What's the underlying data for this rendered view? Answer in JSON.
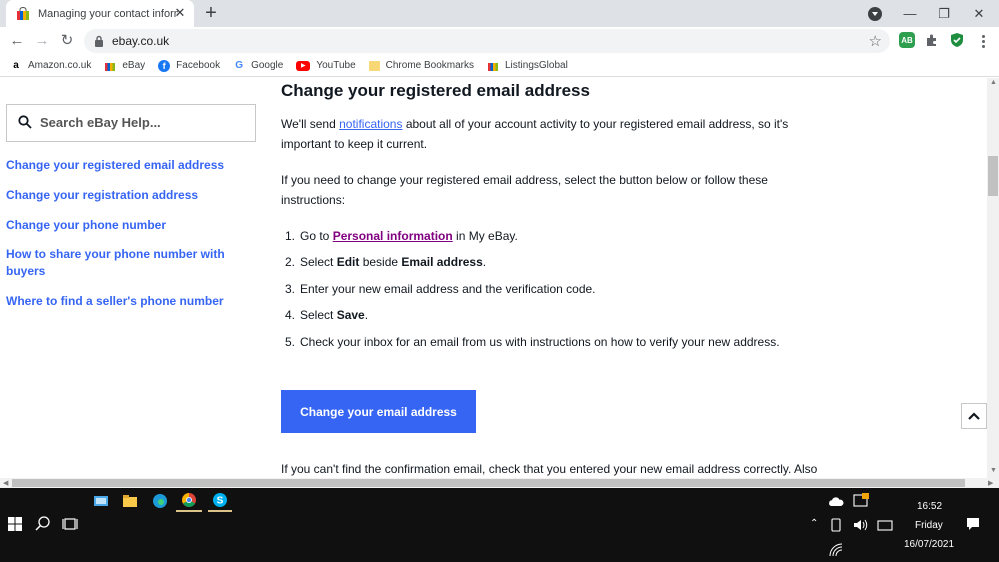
{
  "browser": {
    "tab_title": "Managing your contact informat",
    "url": "ebay.co.uk",
    "extensions": {
      "adblock": "AB"
    }
  },
  "bookmarks": [
    {
      "label": "Amazon.co.uk",
      "icon": "amazon-icon"
    },
    {
      "label": "eBay",
      "icon": "ebay-bag-icon"
    },
    {
      "label": "Facebook",
      "icon": "facebook-icon"
    },
    {
      "label": "Google",
      "icon": "google-icon"
    },
    {
      "label": "YouTube",
      "icon": "youtube-icon"
    },
    {
      "label": "Chrome Bookmarks",
      "icon": "folder-icon"
    },
    {
      "label": "ListingsGlobal",
      "icon": "listings-icon"
    }
  ],
  "sidebar": {
    "search_placeholder": "Search eBay Help...",
    "links": [
      {
        "label": "Change your registered email address"
      },
      {
        "label": "Change your registration address"
      },
      {
        "label": "Change your phone number"
      },
      {
        "label": "How to share your phone number with buyers"
      },
      {
        "label": "Where to find a seller's phone number"
      }
    ]
  },
  "main": {
    "heading": "Change your registered email address",
    "para1_pre": "We'll send ",
    "para1_link": "notifications",
    "para1_post": " about all of your account activity to your registered email address, so it's important to keep it current.",
    "para2": "If you need to change your registered email address, select the button below or follow these instructions:",
    "steps": [
      {
        "num": "1.",
        "pre": "Go to ",
        "link": "Personal information",
        "post": " in My eBay."
      },
      {
        "num": "2.",
        "pre": "Select ",
        "b1": "Edit",
        "mid": " beside ",
        "b2": "Email address",
        "post": "."
      },
      {
        "num": "3.",
        "text": "Enter your new email address and the verification code."
      },
      {
        "num": "4.",
        "pre": "Select ",
        "b1": "Save",
        "post": "."
      },
      {
        "num": "5.",
        "text": "Check your inbox for an email from us with instructions on how to verify your new address."
      }
    ],
    "cta": "Change your email address",
    "para3": "If you can't find the confirmation email, check that you entered your new email address correctly. Also"
  },
  "taskbar": {
    "time": "16:52",
    "day": "Friday",
    "date": "16/07/2021"
  },
  "colors": {
    "ebay_blue": "#3665f3",
    "visited": "#800080",
    "taskbar": "#101010"
  }
}
